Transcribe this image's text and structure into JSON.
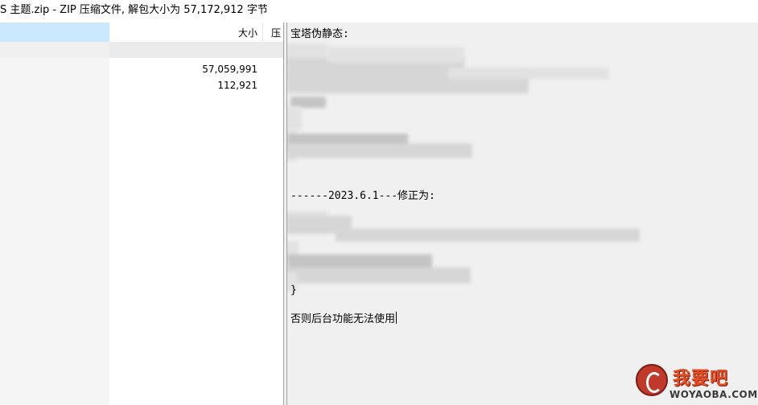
{
  "window": {
    "title": "S 主题.zip - ZIP 压缩文件, 解包大小为 57,172,912 字节"
  },
  "file_list": {
    "columns": {
      "size": "大小",
      "compressed": "压"
    },
    "rows": [
      {
        "size": "57,059,991"
      },
      {
        "size": "112,921"
      }
    ]
  },
  "comment": {
    "heading": "宝塔伪静态:",
    "fix_line": "------2023.6.1---修正为:",
    "closing_brace": "}",
    "warning": "否则后台功能无法使用"
  },
  "watermark": {
    "cn": "我要吧",
    "en": "WOYAOBA.COM"
  }
}
